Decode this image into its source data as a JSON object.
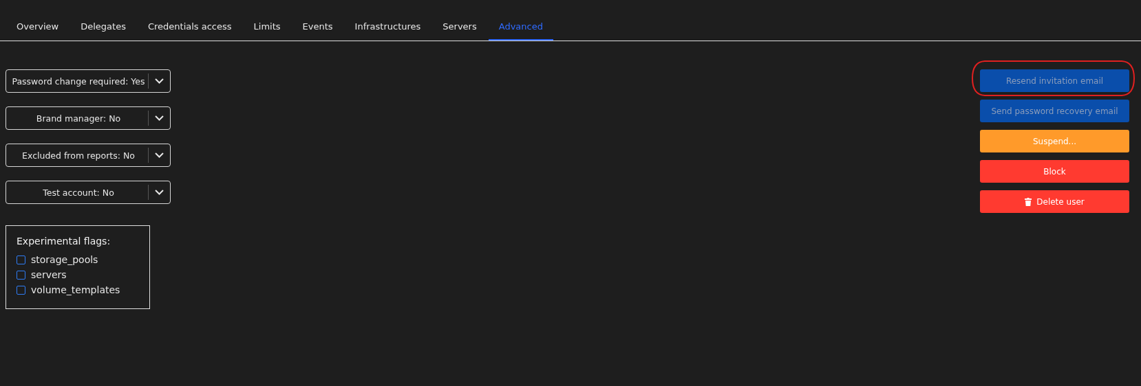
{
  "tabs": [
    {
      "label": "Overview",
      "selected": false
    },
    {
      "label": "Delegates",
      "selected": false
    },
    {
      "label": "Credentials access",
      "selected": false
    },
    {
      "label": "Limits",
      "selected": false
    },
    {
      "label": "Events",
      "selected": false
    },
    {
      "label": "Infrastructures",
      "selected": false
    },
    {
      "label": "Servers",
      "selected": false
    },
    {
      "label": "Advanced",
      "selected": true
    }
  ],
  "dropdowns": [
    {
      "value": "Password change required: Yes"
    },
    {
      "value": "Brand manager: No"
    },
    {
      "value": "Excluded from reports: No"
    },
    {
      "value": "Test account: No"
    }
  ],
  "experimental_flags": {
    "title": "Experimental flags:",
    "flags": [
      {
        "label": "storage_pools",
        "checked": false
      },
      {
        "label": "servers",
        "checked": false
      },
      {
        "label": "volume_templates",
        "checked": false
      }
    ]
  },
  "actions": [
    {
      "label": "Resend invitation email",
      "kind": "primary",
      "disabled": true,
      "circled": true
    },
    {
      "label": "Send password recovery email",
      "kind": "primary",
      "disabled": true,
      "circled": false
    },
    {
      "label": "Suspend...",
      "kind": "warning",
      "disabled": false,
      "circled": false
    },
    {
      "label": "Block",
      "kind": "danger",
      "disabled": false,
      "circled": false
    },
    {
      "label": "Delete user",
      "kind": "delete",
      "disabled": false,
      "circled": false
    }
  ]
}
